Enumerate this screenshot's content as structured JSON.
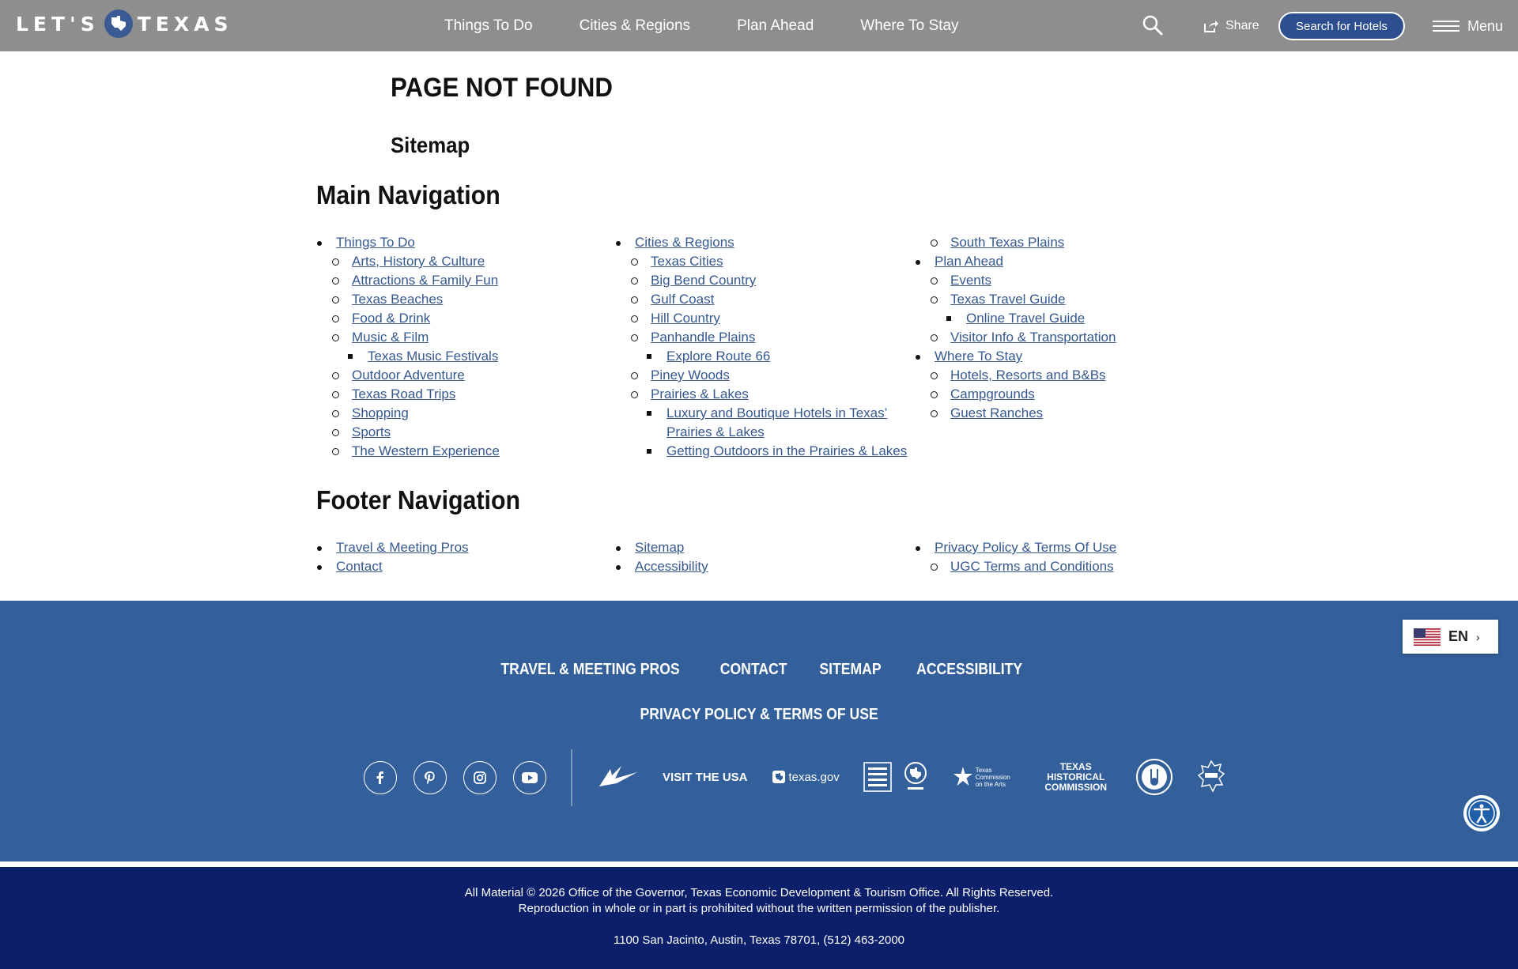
{
  "header": {
    "logo_left": "LET'S",
    "logo_right": "TEXAS",
    "nav": [
      "Things To Do",
      "Cities & Regions",
      "Plan Ahead",
      "Where To Stay"
    ],
    "share_label": "Share",
    "hotels_label": "Search for Hotels",
    "menu_label": "Menu"
  },
  "page": {
    "title": "PAGE NOT FOUND",
    "sitemap": "Sitemap",
    "main_nav_title": "Main Navigation",
    "footer_nav_title": "Footer Navigation"
  },
  "main_nav": {
    "col1": [
      {
        "level": 1,
        "label": "Things To Do"
      },
      {
        "level": 2,
        "label": "Arts, History & Culture"
      },
      {
        "level": 2,
        "label": "Attractions & Family Fun"
      },
      {
        "level": 2,
        "label": "Texas Beaches"
      },
      {
        "level": 2,
        "label": "Food & Drink"
      },
      {
        "level": 2,
        "label": "Music & Film"
      },
      {
        "level": 3,
        "label": "Texas Music Festivals"
      },
      {
        "level": 2,
        "label": "Outdoor Adventure"
      },
      {
        "level": 2,
        "label": "Texas Road Trips"
      },
      {
        "level": 2,
        "label": "Shopping"
      },
      {
        "level": 2,
        "label": "Sports"
      },
      {
        "level": 2,
        "label": "The Western Experience"
      }
    ],
    "col2": [
      {
        "level": 1,
        "label": "Cities & Regions"
      },
      {
        "level": 2,
        "label": "Texas Cities"
      },
      {
        "level": 2,
        "label": "Big Bend Country"
      },
      {
        "level": 2,
        "label": "Gulf Coast"
      },
      {
        "level": 2,
        "label": "Hill Country"
      },
      {
        "level": 2,
        "label": "Panhandle Plains"
      },
      {
        "level": 3,
        "label": "Explore Route 66"
      },
      {
        "level": 2,
        "label": "Piney Woods"
      },
      {
        "level": 2,
        "label": "Prairies & Lakes"
      },
      {
        "level": 3,
        "label": "Luxury and Boutique Hotels in Texas’ Prairies & Lakes"
      },
      {
        "level": 3,
        "label": "Getting Outdoors in the Prairies & Lakes"
      }
    ],
    "col3": [
      {
        "level": 2,
        "label": "South Texas Plains"
      },
      {
        "level": 1,
        "label": "Plan Ahead"
      },
      {
        "level": 2,
        "label": "Events"
      },
      {
        "level": 2,
        "label": "Texas Travel Guide"
      },
      {
        "level": 3,
        "label": "Online Travel Guide"
      },
      {
        "level": 2,
        "label": "Visitor Info & Transportation"
      },
      {
        "level": 1,
        "label": "Where To Stay"
      },
      {
        "level": 2,
        "label": "Hotels, Resorts and B&Bs"
      },
      {
        "level": 2,
        "label": "Campgrounds"
      },
      {
        "level": 2,
        "label": "Guest Ranches"
      }
    ]
  },
  "footer_nav": {
    "col1": [
      {
        "level": 1,
        "label": "Travel & Meeting Pros"
      },
      {
        "level": 1,
        "label": "Contact"
      }
    ],
    "col2": [
      {
        "level": 1,
        "label": "Sitemap"
      },
      {
        "level": 1,
        "label": "Accessibility"
      }
    ],
    "col3": [
      {
        "level": 1,
        "label": "Privacy Policy & Terms Of Use"
      },
      {
        "level": 2,
        "label": "UGC Terms and Conditions"
      }
    ]
  },
  "footer": {
    "links": [
      "TRAVEL & MEETING PROS",
      "CONTACT",
      "SITEMAP",
      "ACCESSIBILITY"
    ],
    "privacy": "PRIVACY POLICY & TERMS OF USE",
    "social_icons": [
      "facebook-icon",
      "pinterest-icon",
      "instagram-icon",
      "youtube-icon"
    ],
    "partners": {
      "txdot": "Texas Department of Transportation",
      "visit_usa": "VISIT THE USA",
      "texas_gov": "texas.gov",
      "tpwd": "TEXAS PARKS & WILDLIFE",
      "go_texan": "GO TEXAN",
      "arts": "Texas Commission on the Arts",
      "historical": "TEXAS HISTORICAL COMMISSION",
      "music": "TEXAS MUSIC OFFICE",
      "film": "Texas FILM"
    },
    "language": "EN",
    "copyright_1": "All Material © 2026 Office of the Governor, Texas Economic Development & Tourism Office. All Rights Reserved.",
    "copyright_2": "Reproduction in whole or in part is prohibited without the written permission of the publisher.",
    "address": "1100 San Jacinto, Austin, Texas 78701, (512) 463-2000"
  },
  "colors": {
    "header_bg": "#8e8e8e",
    "link": "#35588f",
    "footer_blue": "#33609a",
    "footer_dark": "#0b1f6b"
  }
}
